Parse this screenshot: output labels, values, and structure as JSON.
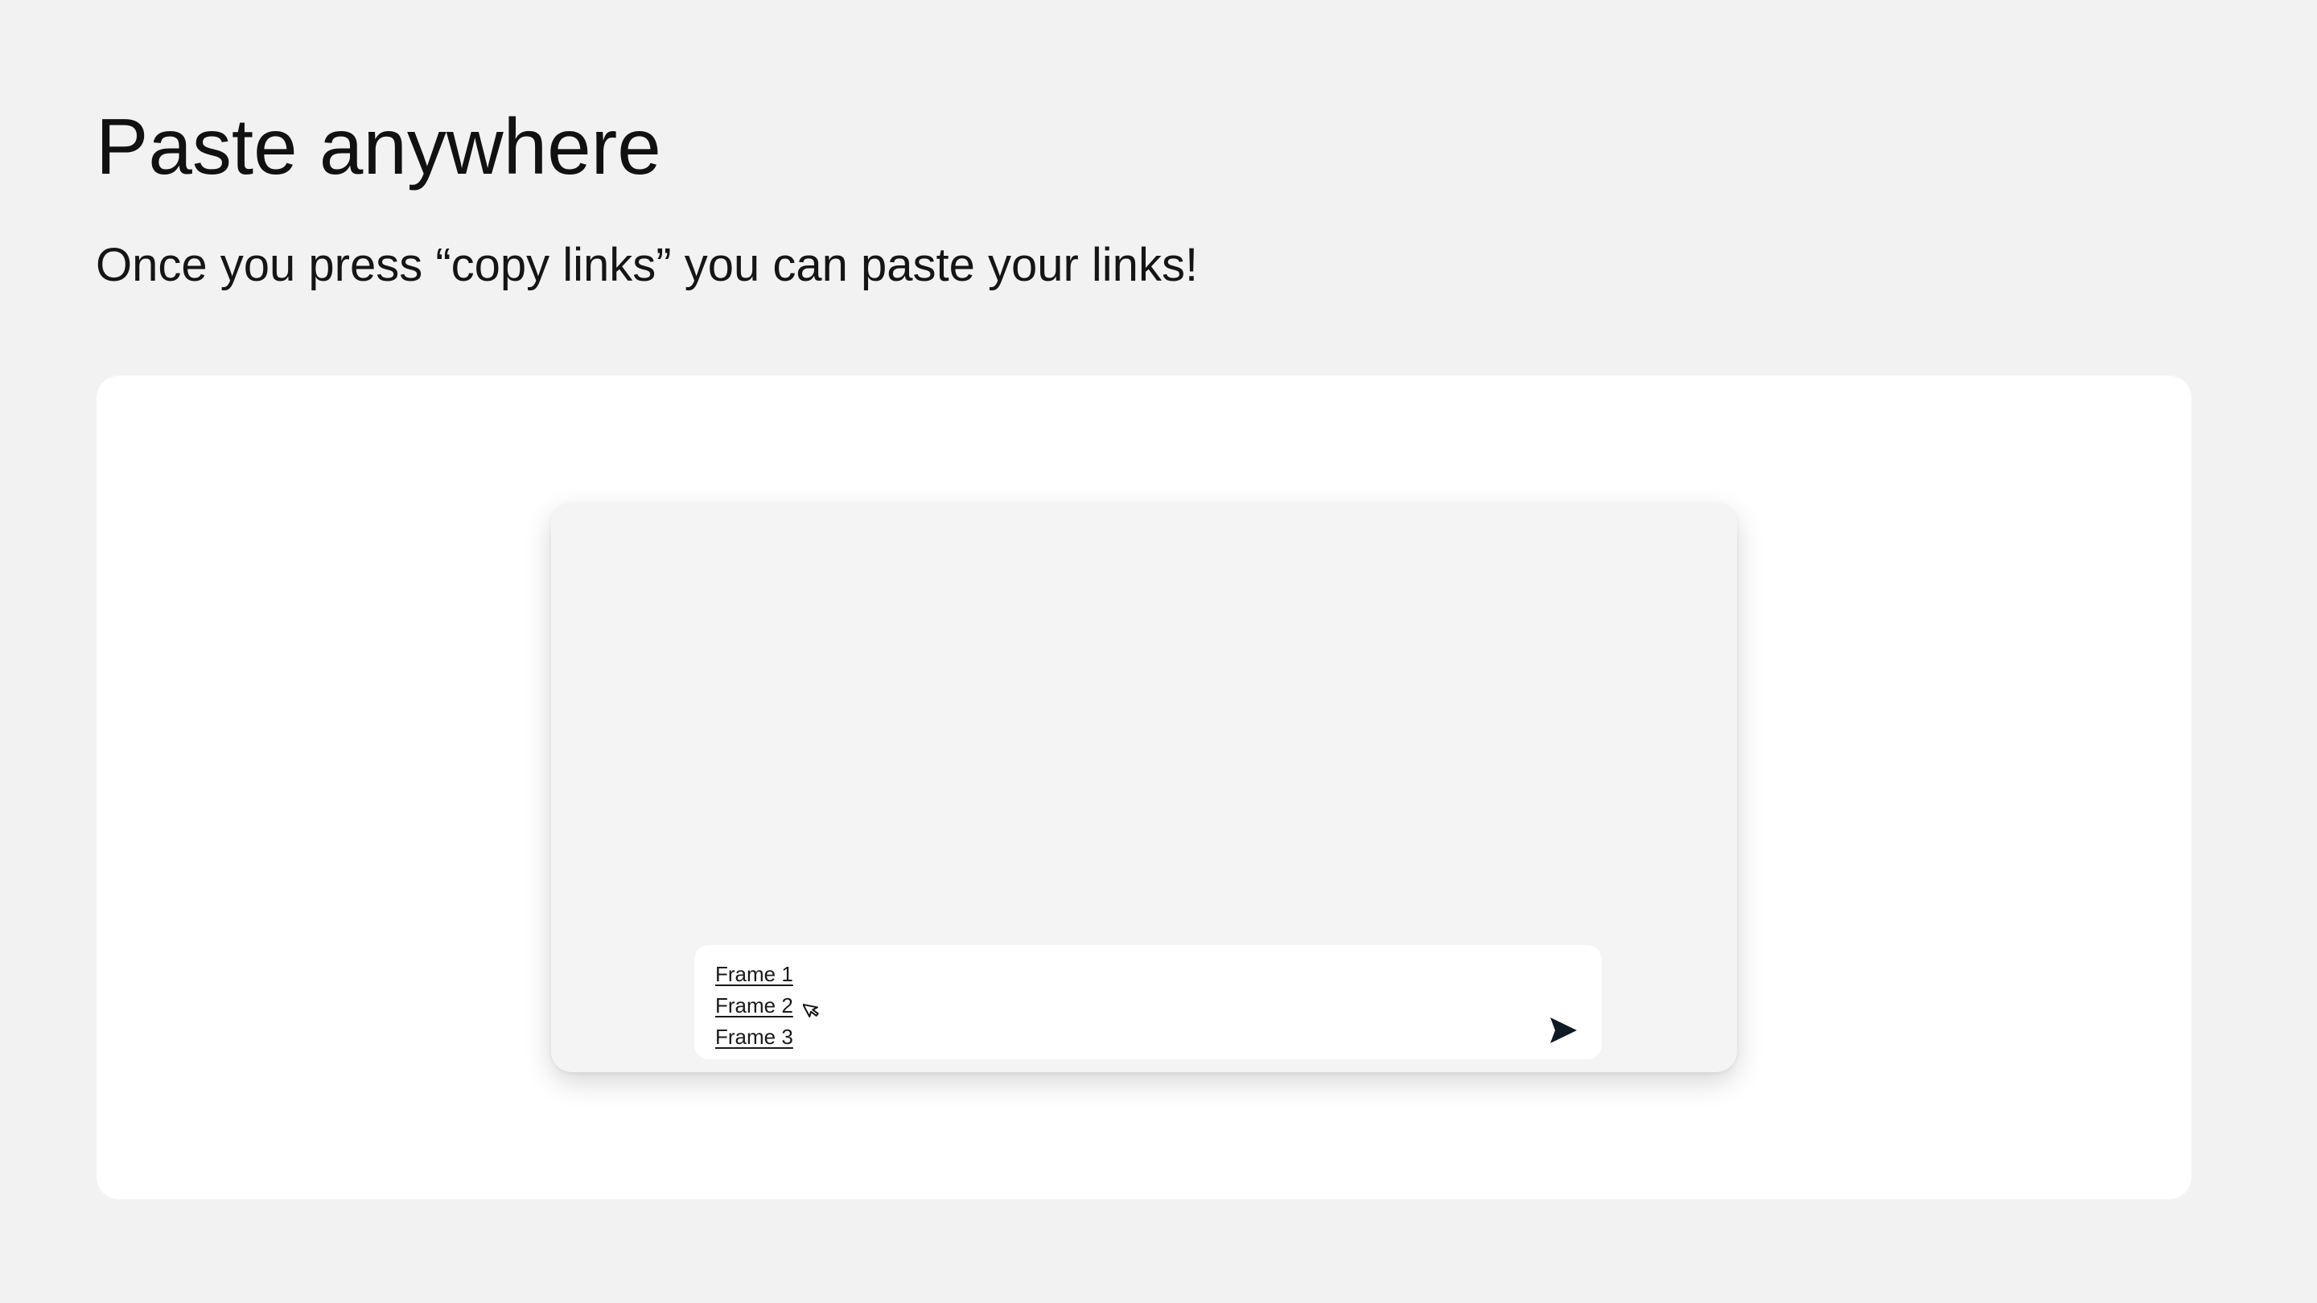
{
  "header": {
    "title": "Paste anywhere",
    "subtitle": "Once you press “copy links” you can paste your links!"
  },
  "composer": {
    "links": [
      "Frame 1",
      "Frame 2",
      "Frame 3"
    ],
    "send_icon": "send-icon",
    "cursor_icon": "mouse-cursor-icon"
  },
  "colors": {
    "page_background": "#f2f2f2",
    "stage_background": "#ffffff",
    "window_background": "#f4f4f4",
    "text": "#111111",
    "icon": "#0e1a26"
  }
}
